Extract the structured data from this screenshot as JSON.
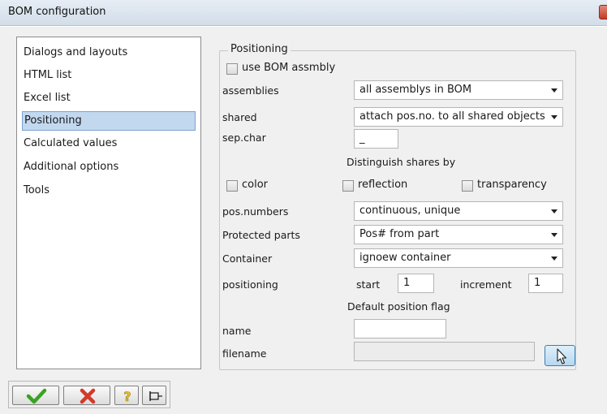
{
  "window": {
    "title": "BOM configuration"
  },
  "nav": {
    "items": [
      {
        "label": "Dialogs and layouts",
        "selected": false
      },
      {
        "label": "HTML list",
        "selected": false
      },
      {
        "label": "Excel list",
        "selected": false
      },
      {
        "label": "Positioning",
        "selected": true
      },
      {
        "label": "Calculated values",
        "selected": false
      },
      {
        "label": "Additional options",
        "selected": false
      },
      {
        "label": "Tools",
        "selected": false
      }
    ]
  },
  "positioning": {
    "group_title": "Positioning",
    "use_bom_assembly": {
      "label": "use BOM assmbly",
      "checked": false
    },
    "assemblies": {
      "label": "assemblies",
      "value": "all assemblys in BOM"
    },
    "shared": {
      "label": "shared",
      "value": "attach pos.no. to all shared objects"
    },
    "sep_char": {
      "label": "sep.char",
      "value": "_"
    },
    "distinguish_heading": "Distinguish shares by",
    "color": {
      "label": "color",
      "checked": false
    },
    "reflection": {
      "label": "reflection",
      "checked": false
    },
    "transparency": {
      "label": "transparency",
      "checked": false
    },
    "pos_numbers": {
      "label": "pos.numbers",
      "value": "continuous, unique"
    },
    "protected_parts": {
      "label": "Protected parts",
      "value": "Pos# from part"
    },
    "container": {
      "label": "Container",
      "value": "ignoew container"
    },
    "positioning_row": {
      "label": "positioning",
      "start_label": "start",
      "start_value": "1",
      "increment_label": "increment",
      "increment_value": "1"
    },
    "default_flag_heading": "Default position flag",
    "name": {
      "label": "name",
      "value": ""
    },
    "filename": {
      "label": "filename",
      "value": ""
    }
  },
  "icons": {
    "ok": "green-checkmark-icon",
    "cancel": "red-x-icon",
    "help": "question-mark-icon",
    "pin": "pin-icon",
    "browse": "cursor-pointer-icon",
    "close": "window-close-icon"
  },
  "colors": {
    "selection": "#c2d8ef",
    "ok_green": "#3aa321",
    "cancel_red": "#d23a2a",
    "help_yellow": "#e8c12a",
    "browse_blue": "#b6d8f0"
  }
}
